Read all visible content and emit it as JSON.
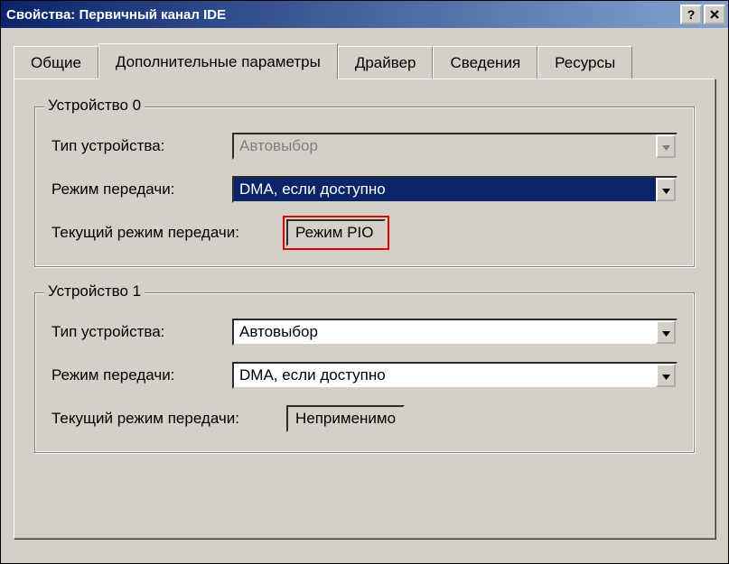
{
  "window": {
    "title": "Свойства: Первичный канал IDE",
    "help_label": "?"
  },
  "tabs": {
    "general": "Общие",
    "advanced": "Дополнительные параметры",
    "driver": "Драйвер",
    "details": "Сведения",
    "resources": "Ресурсы"
  },
  "device0": {
    "legend": "Устройство 0",
    "type_label": "Тип устройства:",
    "type_value": "Автовыбор",
    "mode_label": "Режим передачи:",
    "mode_value": "DMA, если доступно",
    "current_label": "Текущий режим передачи:",
    "current_value": "Режим PIO"
  },
  "device1": {
    "legend": "Устройство 1",
    "type_label": "Тип устройства:",
    "type_value": "Автовыбор",
    "mode_label": "Режим передачи:",
    "mode_value": "DMA, если доступно",
    "current_label": "Текущий режим передачи:",
    "current_value": "Неприменимо"
  }
}
